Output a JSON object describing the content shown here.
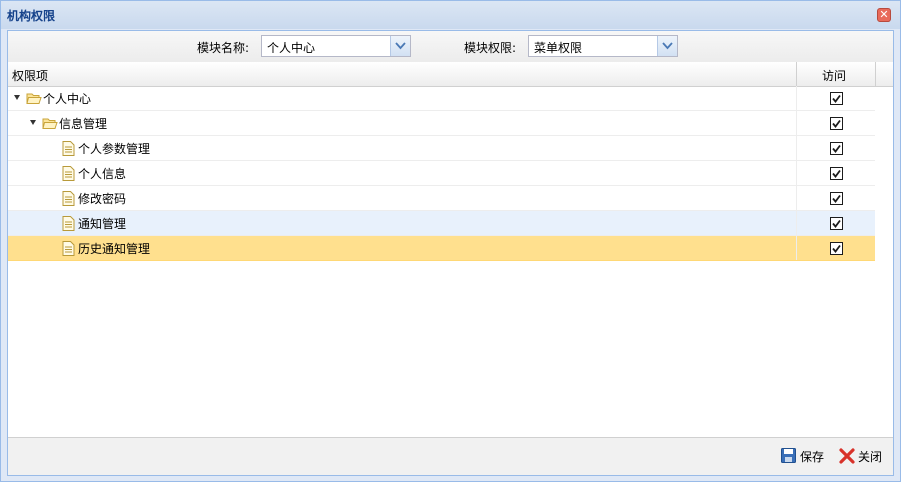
{
  "window": {
    "title": "机构权限",
    "close_icon": "close-icon"
  },
  "toolbar": {
    "module_name_label": "模块名称:",
    "module_name_value": "个人中心",
    "module_perm_label": "模块权限:",
    "module_perm_value": "菜单权限"
  },
  "grid": {
    "columns": {
      "item": "权限项",
      "access": "访问"
    },
    "rows": [
      {
        "label": "个人中心",
        "icon": "folder-open-icon",
        "level": 0,
        "expander": true,
        "checked": true
      },
      {
        "label": "信息管理",
        "icon": "folder-open-icon",
        "level": 1,
        "expander": true,
        "checked": true
      },
      {
        "label": "个人参数管理",
        "icon": "document-icon",
        "level": 2,
        "expander": false,
        "checked": true
      },
      {
        "label": "个人信息",
        "icon": "document-icon",
        "level": 2,
        "expander": false,
        "checked": true
      },
      {
        "label": "修改密码",
        "icon": "document-icon",
        "level": 2,
        "expander": false,
        "checked": true
      },
      {
        "label": "通知管理",
        "icon": "document-icon",
        "level": 2,
        "expander": false,
        "checked": true
      },
      {
        "label": "历史通知管理",
        "icon": "document-icon",
        "level": 2,
        "expander": false,
        "checked": true
      }
    ]
  },
  "footer": {
    "save_label": "保存",
    "close_label": "关闭"
  },
  "colors": {
    "title": "#15428b",
    "selected_row": "#ffe08e",
    "hover_row": "#e8f1fc",
    "border": "#99bbe8"
  }
}
